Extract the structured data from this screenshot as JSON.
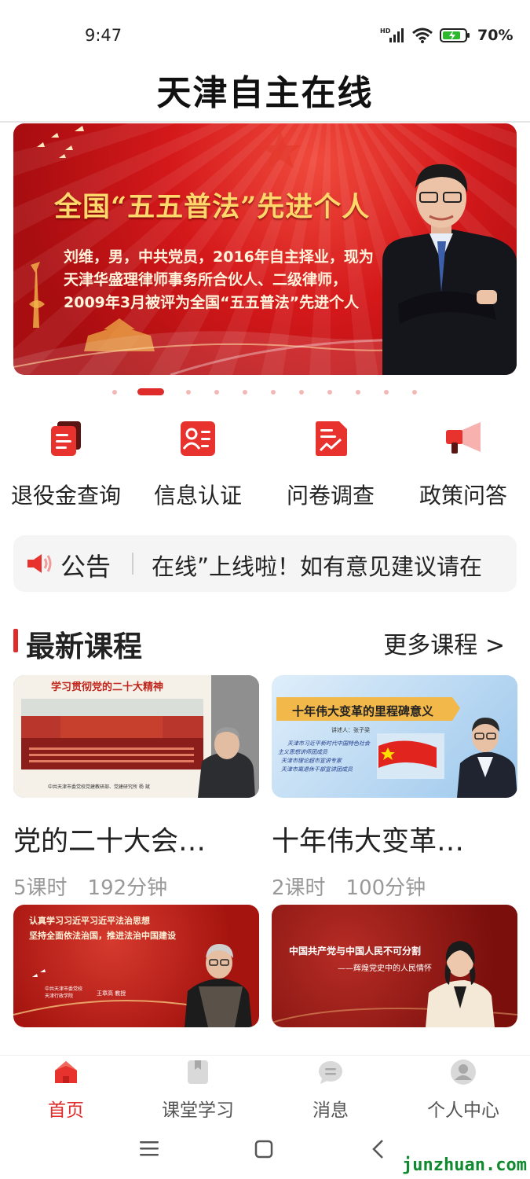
{
  "status_bar": {
    "time": "9:47",
    "signal_label": "HD",
    "battery": "70%"
  },
  "app": {
    "title": "天津自主在线"
  },
  "banner": {
    "title": "全国“五五普法”先进个人",
    "description": "刘维，男，中共党员，2016年自主择业，现为天津华盛理律师事务所合伙人、二级律师，2009年3月被评为全国“五五普法”先进个人"
  },
  "carousel": {
    "count": 12,
    "active_index": 1
  },
  "quick_actions": [
    {
      "label": "退役金查询",
      "icon": "document-stack-icon"
    },
    {
      "label": "信息认证",
      "icon": "id-card-icon"
    },
    {
      "label": "问卷调查",
      "icon": "survey-chart-icon"
    },
    {
      "label": "政策问答",
      "icon": "megaphone-icon"
    }
  ],
  "notice": {
    "label": "公告",
    "text": "在线”上线啦！如有意见建议请在"
  },
  "section": {
    "title": "最新课程",
    "more": "更多课程 >"
  },
  "courses": [
    {
      "title": "党的二十大会…",
      "lessons": "5课时",
      "duration": "192分钟",
      "thumb_heading": "学习贯彻党的二十大精神",
      "thumb_caption": "中共天津市委党校党建教研部、党建研究所  杨  斌"
    },
    {
      "title": "十年伟大变革…",
      "lessons": "2课时",
      "duration": "100分钟",
      "thumb_heading": "十年伟大变革的里程碑意义",
      "thumb_speaker": "讲述人：张子梁",
      "thumb_lines": [
        "天津市习近平新时代中国特色社会",
        "主义思想讲师团成员",
        "天津市理论超市宣讲专家",
        "天津市离退休干部宣讲团成员"
      ]
    },
    {
      "thumb_heading": "认真学习习近平习近平法治思想",
      "thumb_heading2": "坚持全面依法治国，推进法治中国建设",
      "thumb_org": "中共天津市委党校\n天津行政学院",
      "thumb_speaker": "王章高 教授"
    },
    {
      "thumb_heading": "中国共产党与中国人民不可分割",
      "thumb_heading2": "——辉煌党史中的人民情怀"
    }
  ],
  "tabs": [
    {
      "label": "首页",
      "icon": "home-icon",
      "active": true
    },
    {
      "label": "课堂学习",
      "icon": "bookmark-icon",
      "active": false
    },
    {
      "label": "消息",
      "icon": "message-icon",
      "active": false
    },
    {
      "label": "个人中心",
      "icon": "person-icon",
      "active": false
    }
  ],
  "watermark": "junzhuan.com",
  "colors": {
    "accent": "#e02b2b",
    "banner_gold": "#ffd76a"
  }
}
